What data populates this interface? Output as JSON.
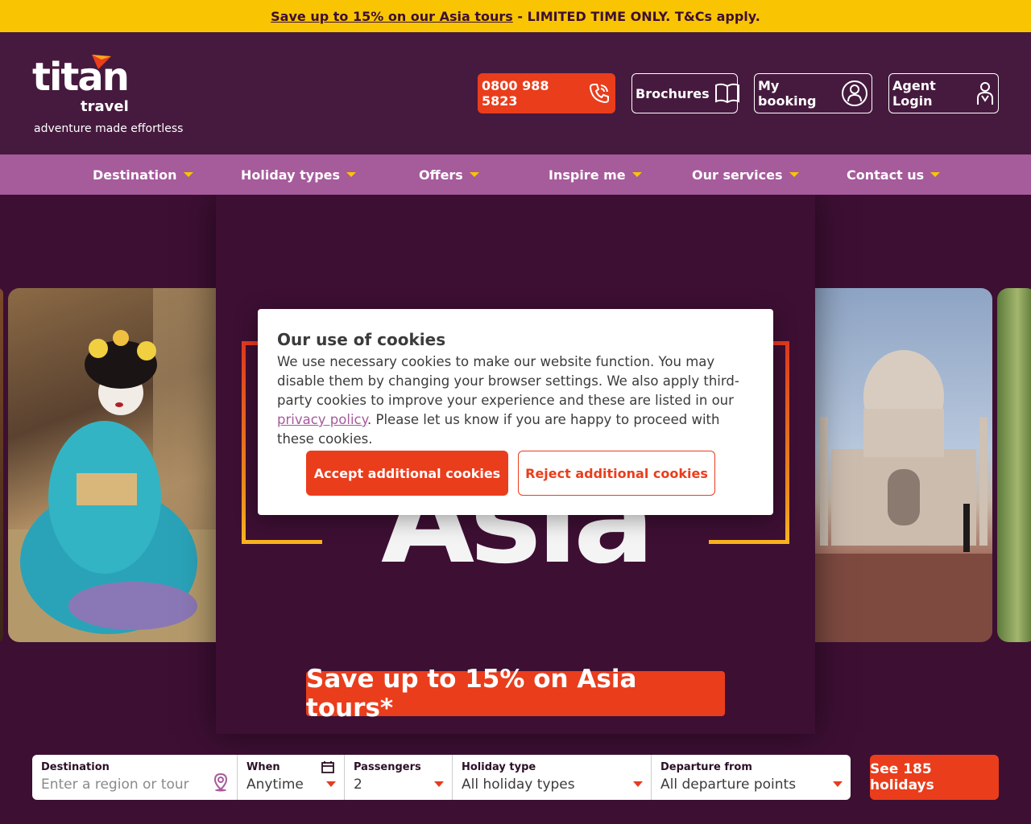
{
  "promo": {
    "link_text": "Save up to 15% on our Asia tours",
    "rest_text": " - LIMITED TIME ONLY. T&Cs apply."
  },
  "header": {
    "logo_word": "titan",
    "logo_sub": "travel",
    "tagline": "adventure made effortless",
    "phone": "0800 988 5823",
    "brochures": "Brochures",
    "my_booking": "My booking",
    "agent_login": "Agent Login"
  },
  "nav": {
    "items": [
      {
        "label": "Destination"
      },
      {
        "label": "Holiday types"
      },
      {
        "label": "Offers"
      },
      {
        "label": "Inspire me"
      },
      {
        "label": "Our services"
      },
      {
        "label": "Contact us"
      }
    ]
  },
  "hero": {
    "title": "Asia",
    "banner": "Save up to 15% on Asia tours*"
  },
  "search": {
    "destination": {
      "label": "Destination",
      "placeholder": "Enter a region or tour"
    },
    "when": {
      "label": "When",
      "value": "Anytime"
    },
    "passengers": {
      "label": "Passengers",
      "value": "2"
    },
    "holiday_type": {
      "label": "Holiday type",
      "value": "All holiday types"
    },
    "departure": {
      "label": "Departure from",
      "value": "All departure points"
    },
    "submit": "See 185 holidays"
  },
  "cookie": {
    "title": "Our use of cookies",
    "text_before": "We use necessary cookies to make our website function. You may disable them by changing your browser settings. We also apply third-party cookies to improve your experience and these are listed in our ",
    "link": "privacy policy",
    "text_after": ". Please let us know if you are happy to proceed with these cookies.",
    "accept": "Accept additional cookies",
    "reject": "Reject additional cookies"
  },
  "colors": {
    "brand_purple": "#461a3e",
    "nav_purple": "#a65b9b",
    "accent_orange": "#ea3d1c",
    "promo_yellow": "#f9c503"
  },
  "icons": [
    "phone-icon",
    "book-icon",
    "user-icon",
    "agent-icon",
    "caret-icon",
    "pin-icon",
    "calendar-icon"
  ]
}
